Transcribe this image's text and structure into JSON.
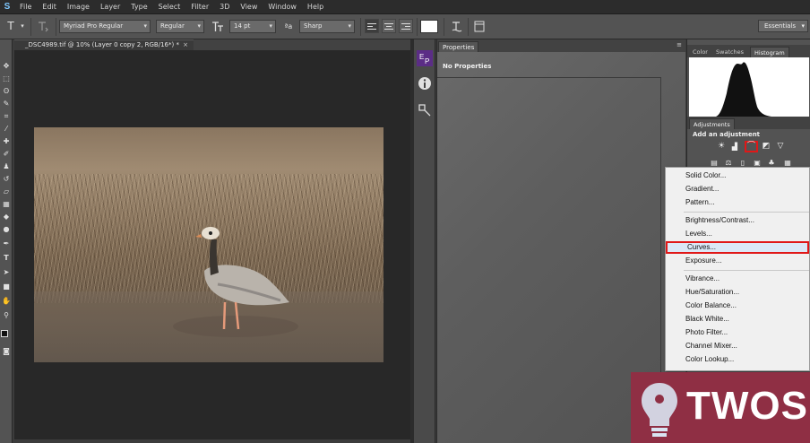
{
  "menubar": {
    "logo": "S",
    "items": [
      "File",
      "Edit",
      "Image",
      "Layer",
      "Type",
      "Select",
      "Filter",
      "3D",
      "View",
      "Window",
      "Help"
    ]
  },
  "options": {
    "tool_glyph": "T",
    "font_family": "Myriad Pro Regular",
    "font_style": "Regular",
    "font_size": "14 pt",
    "aa_glyph": "ªa",
    "antialias": "Sharp",
    "workspace": "Essentials"
  },
  "document": {
    "tab_title": "_DSC4989.tif @ 10% (Layer 0 copy 2, RGB/16*) *",
    "close_glyph": "×"
  },
  "properties": {
    "tab_label": "Properties",
    "empty_text": "No Properties",
    "menu_glyph": "≡"
  },
  "right_panel": {
    "top_tabs": [
      "Color",
      "Swatches",
      "Histogram"
    ],
    "adj_tab": "Adjustments",
    "adj_heading": "Add an adjustment"
  },
  "adjustment_menu": {
    "groups": [
      [
        "Solid Color...",
        "Gradient...",
        "Pattern..."
      ],
      [
        "Brightness/Contrast...",
        "Levels...",
        "Curves...",
        "Exposure..."
      ],
      [
        "Vibrance...",
        "Hue/Saturation...",
        "Color Balance...",
        "Black  White...",
        "Photo Filter...",
        "Channel Mixer...",
        "Color Lookup..."
      ]
    ],
    "highlighted": "Curves..."
  },
  "watermark": {
    "text": "TWOS"
  },
  "colors": {
    "highlight": "#e01818",
    "watermark_bg": "#8f2f44"
  }
}
